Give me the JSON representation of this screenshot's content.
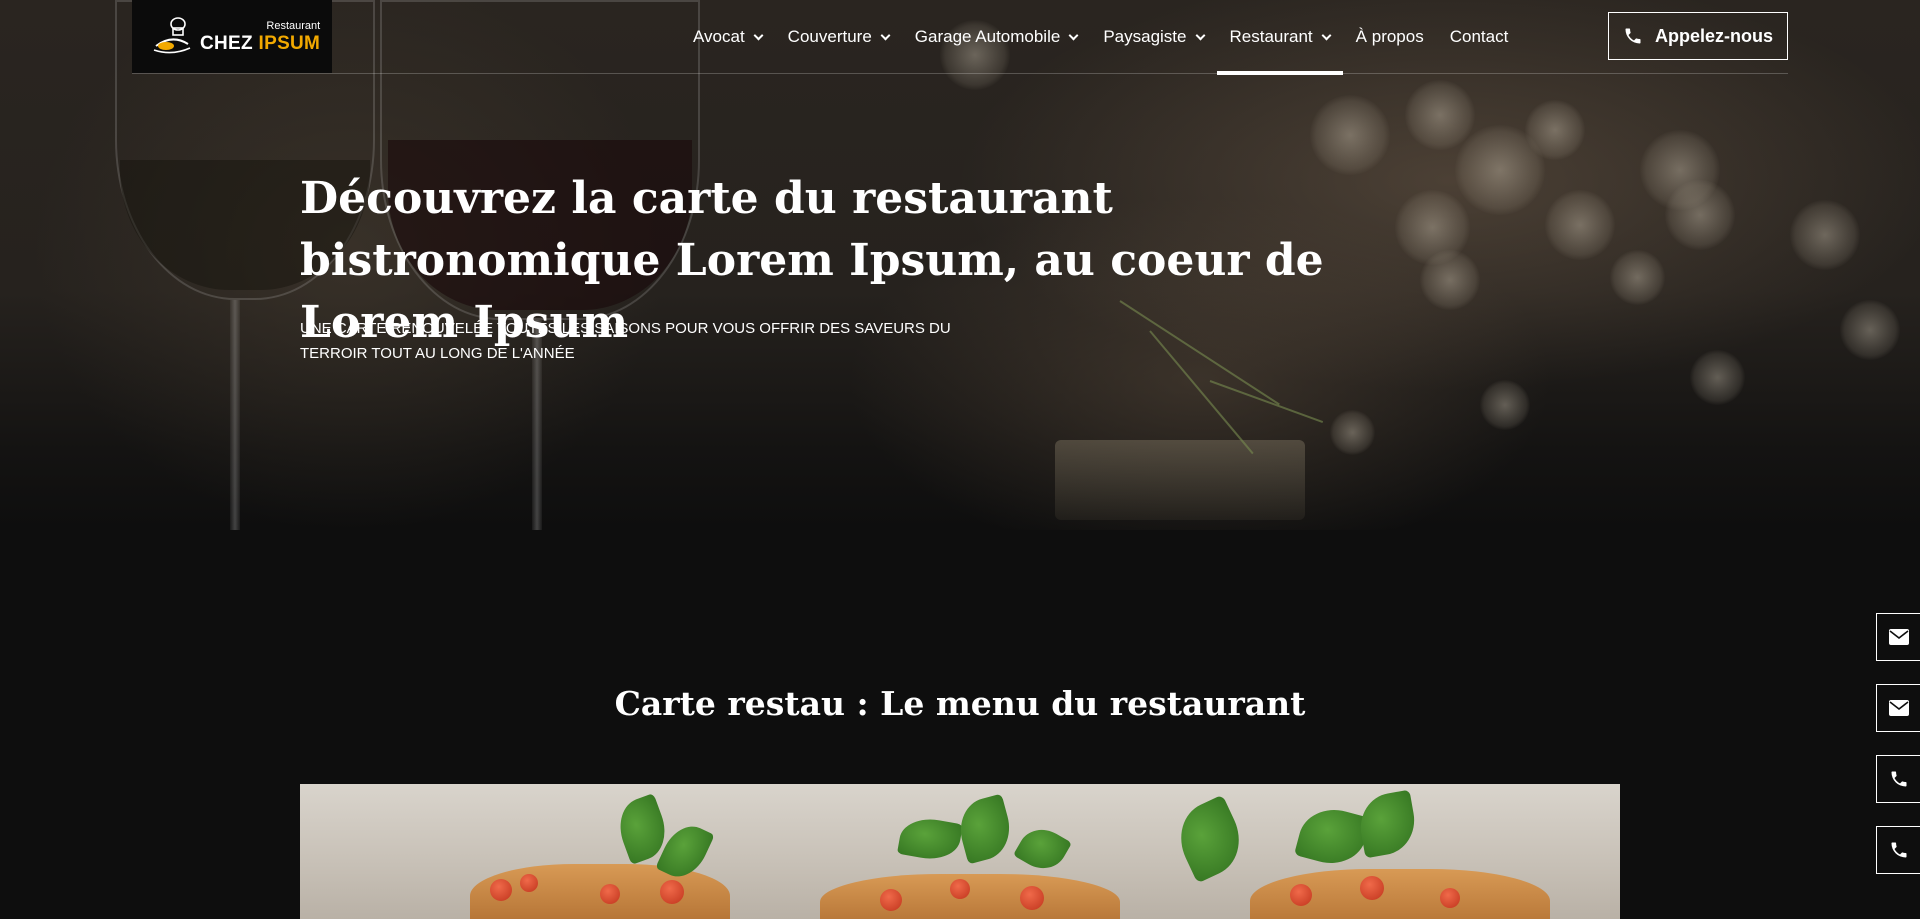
{
  "brand": {
    "small": "Restaurant",
    "name_white": "CHEZ",
    "name_yellow": "IPSUM",
    "accent_color": "#f2a900"
  },
  "nav": {
    "items": [
      {
        "label": "Avocat",
        "has_dropdown": true,
        "active": false
      },
      {
        "label": "Couverture",
        "has_dropdown": true,
        "active": false
      },
      {
        "label": "Garage Automobile",
        "has_dropdown": true,
        "active": false
      },
      {
        "label": "Paysagiste",
        "has_dropdown": true,
        "active": false
      },
      {
        "label": "Restaurant",
        "has_dropdown": true,
        "active": true
      },
      {
        "label": "À propos",
        "has_dropdown": false,
        "active": false
      },
      {
        "label": "Contact",
        "has_dropdown": false,
        "active": false
      }
    ],
    "cta_label": "Appelez-nous",
    "cta_icon": "phone-icon"
  },
  "hero": {
    "title": "Découvrez la carte du restaurant bistronomique Lorem Ipsum, au coeur de Lorem Ipsum",
    "subtitle": "Une carte renouvelée toutes les saisons pour vous offrir des saveurs du terroir tout au long de l'année"
  },
  "section": {
    "title": "Carte restau : Le menu du restaurant"
  },
  "side_contacts": [
    {
      "icon": "envelope-icon"
    },
    {
      "icon": "envelope-icon"
    },
    {
      "icon": "phone-icon"
    },
    {
      "icon": "phone-icon"
    }
  ]
}
